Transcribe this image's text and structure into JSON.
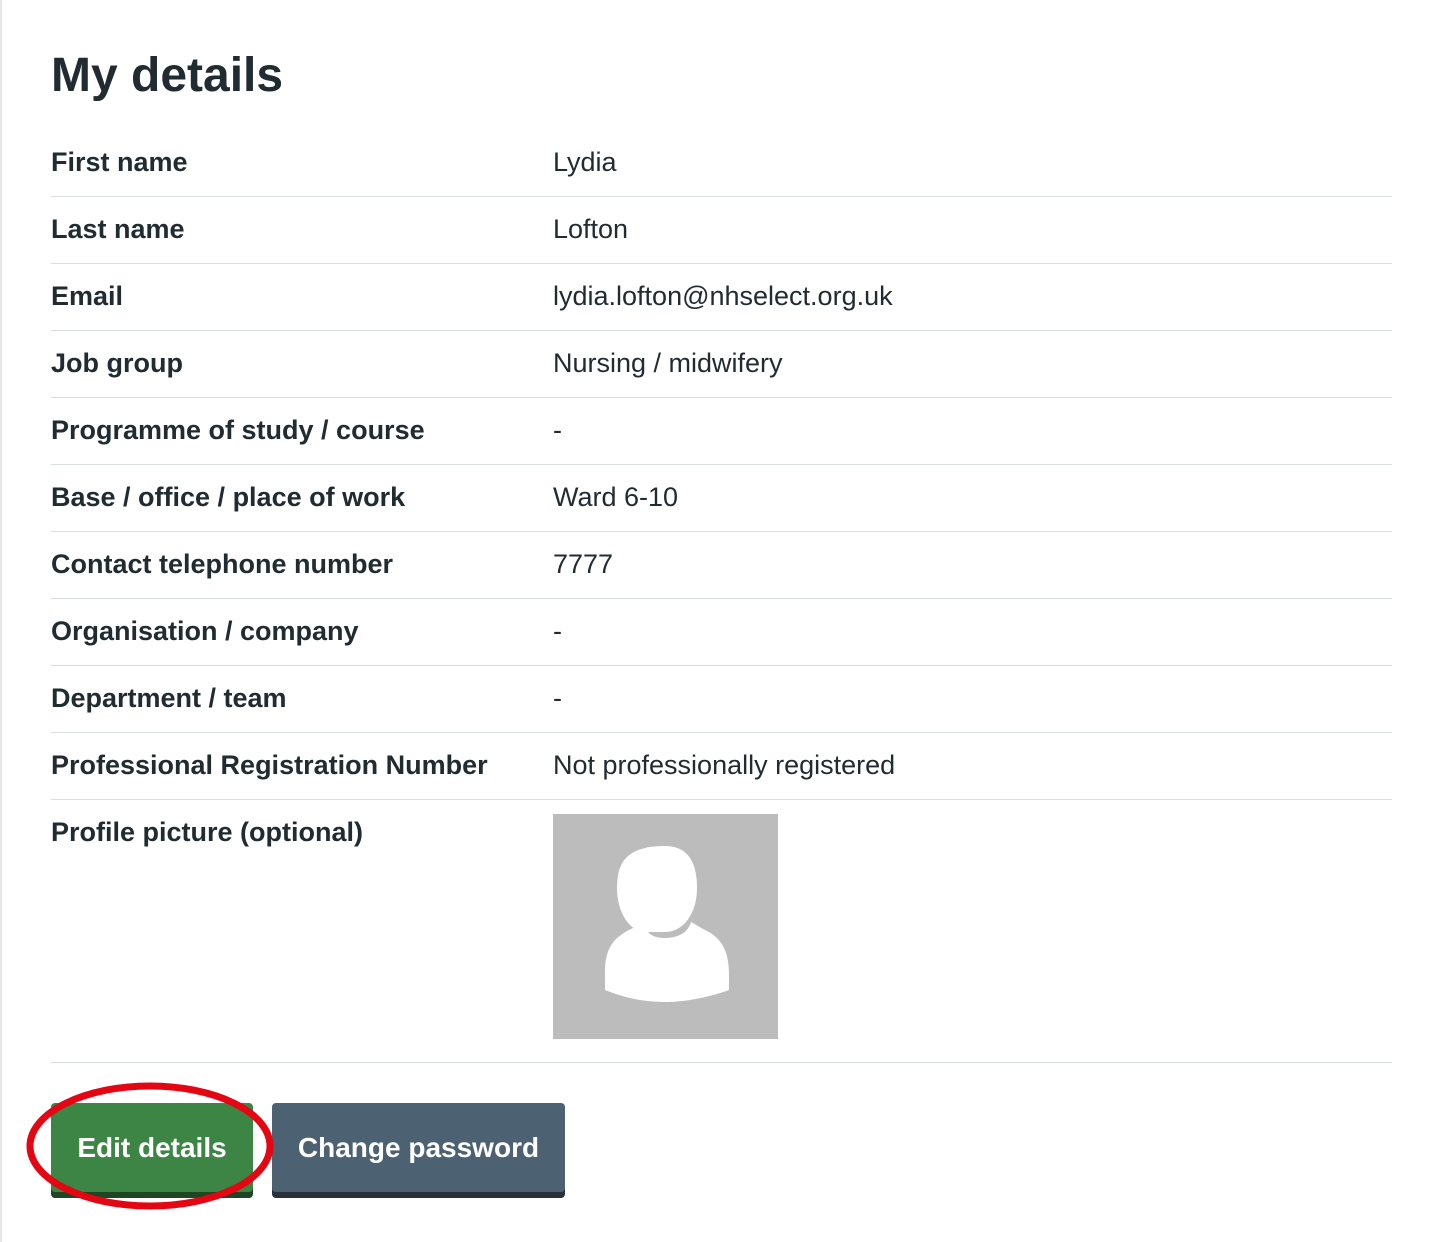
{
  "page": {
    "title": "My details"
  },
  "details": [
    {
      "label": "First name",
      "value": "Lydia"
    },
    {
      "label": "Last name",
      "value": "Lofton"
    },
    {
      "label": "Email",
      "value": "lydia.lofton@nhselect.org.uk"
    },
    {
      "label": "Job group",
      "value": "Nursing / midwifery"
    },
    {
      "label": "Programme of study / course",
      "value": "-"
    },
    {
      "label": "Base / office / place of work",
      "value": "Ward 6-10"
    },
    {
      "label": "Contact telephone number",
      "value": "7777"
    },
    {
      "label": "Organisation / company",
      "value": "-"
    },
    {
      "label": "Department / team",
      "value": "-"
    },
    {
      "label": "Professional Registration Number",
      "value": "Not professionally registered"
    }
  ],
  "profile_picture": {
    "label": "Profile picture (optional)",
    "icon": "default-avatar-icon"
  },
  "actions": {
    "edit_label": "Edit details",
    "change_password_label": "Change password"
  },
  "colors": {
    "primary_green": "#3c8544",
    "secondary_grey": "#4c6272",
    "highlight_red": "#e30613"
  }
}
